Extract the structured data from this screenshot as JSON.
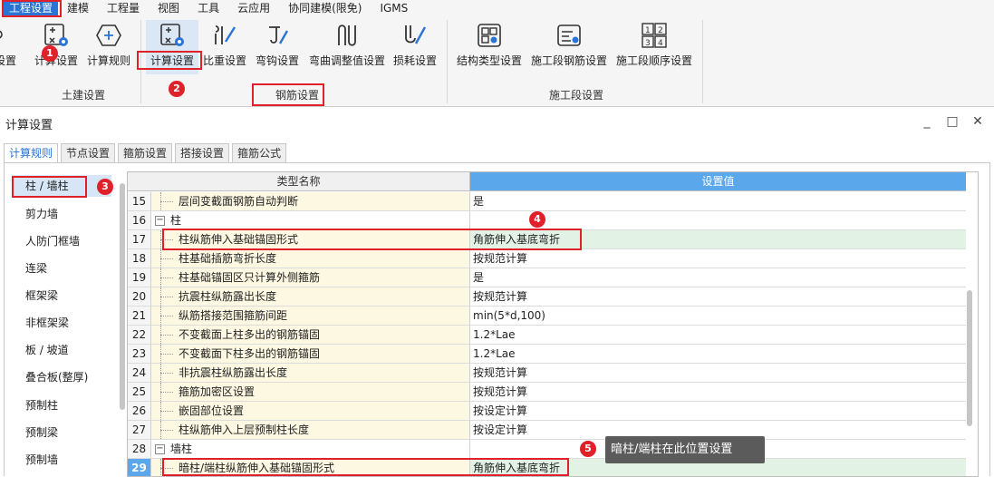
{
  "menubar": {
    "items": [
      "工程设置",
      "建模",
      "工程量",
      "视图",
      "工具",
      "云应用",
      "协同建模(限免)",
      "IGMS"
    ],
    "active_index": 0
  },
  "ribbon": {
    "partial_button_label": "设置",
    "buttons": [
      {
        "label": "计算设置",
        "icon": "calc-settings-icon"
      },
      {
        "label": "计算规则",
        "icon": "calc-rules-icon"
      },
      {
        "label": "计算设置",
        "icon": "calc-settings-icon",
        "selected": true
      },
      {
        "label": "比重设置",
        "icon": "density-icon"
      },
      {
        "label": "弯钩设置",
        "icon": "hook-icon"
      },
      {
        "label": "弯曲调整值设置",
        "icon": "bend-adjust-icon"
      },
      {
        "label": "损耗设置",
        "icon": "loss-icon"
      },
      {
        "label": "结构类型设置",
        "icon": "structure-type-icon"
      },
      {
        "label": "施工段钢筋设置",
        "icon": "segment-rebar-icon"
      },
      {
        "label": "施工段顺序设置",
        "icon": "segment-order-icon"
      }
    ],
    "groups": [
      "土建设置",
      "钢筋设置",
      "施工段设置"
    ]
  },
  "dialog": {
    "title": "计算设置",
    "minimize": "_",
    "maximize": "□",
    "close": "✕",
    "tabs": [
      "计算规则",
      "节点设置",
      "箍筋设置",
      "搭接设置",
      "箍筋公式"
    ],
    "active_tab": 0,
    "sidebar": [
      "柱 / 墙柱",
      "剪力墙",
      "人防门框墙",
      "连梁",
      "框架梁",
      "非框架梁",
      "板 / 坡道",
      "叠合板(整厚)",
      "预制柱",
      "预制梁",
      "预制墙"
    ],
    "sidebar_active": 0,
    "grid": {
      "col_name": "类型名称",
      "col_value": "设置值",
      "rows": [
        {
          "num": "15",
          "name": "层间变截面钢筋自动判断",
          "value": "是",
          "kind": "child"
        },
        {
          "num": "16",
          "name": "柱",
          "value": "",
          "kind": "parent",
          "toggle": "−"
        },
        {
          "num": "17",
          "name": "柱纵筋伸入基础锚固形式",
          "value": "角筋伸入基底弯折",
          "kind": "child",
          "green": true
        },
        {
          "num": "18",
          "name": "柱基础插筋弯折长度",
          "value": "按规范计算",
          "kind": "child"
        },
        {
          "num": "19",
          "name": "柱基础锚固区只计算外侧箍筋",
          "value": "是",
          "kind": "child"
        },
        {
          "num": "20",
          "name": "抗震柱纵筋露出长度",
          "value": "按规范计算",
          "kind": "child"
        },
        {
          "num": "21",
          "name": "纵筋搭接范围箍筋间距",
          "value": "min(5*d,100)",
          "kind": "child"
        },
        {
          "num": "22",
          "name": "不变截面上柱多出的钢筋锚固",
          "value": "1.2*Lae",
          "kind": "child"
        },
        {
          "num": "23",
          "name": "不变截面下柱多出的钢筋锚固",
          "value": "1.2*Lae",
          "kind": "child"
        },
        {
          "num": "24",
          "name": "非抗震柱纵筋露出长度",
          "value": "按规范计算",
          "kind": "child"
        },
        {
          "num": "25",
          "name": "箍筋加密区设置",
          "value": "按规范计算",
          "kind": "child"
        },
        {
          "num": "26",
          "name": "嵌固部位设置",
          "value": "按设定计算",
          "kind": "child"
        },
        {
          "num": "27",
          "name": "柱纵筋伸入上层预制柱长度",
          "value": "按设定计算",
          "kind": "child"
        },
        {
          "num": "28",
          "name": "墙柱",
          "value": "",
          "kind": "parent",
          "toggle": "−"
        },
        {
          "num": "29",
          "name": "暗柱/端柱纵筋伸入基础锚固形式",
          "value": "角筋伸入基底弯折",
          "kind": "child",
          "green": true,
          "current": true
        }
      ]
    }
  },
  "annotations": {
    "badges": [
      "1",
      "2",
      "3",
      "4",
      "5"
    ],
    "tooltip": "暗柱/端柱在此位置设置"
  },
  "colors": {
    "accent": "#2a74d6",
    "header_blue": "#5aa7ec",
    "red": "#e0212a",
    "green_row": "#e2f3e6",
    "name_cell": "#fdf8e2"
  }
}
